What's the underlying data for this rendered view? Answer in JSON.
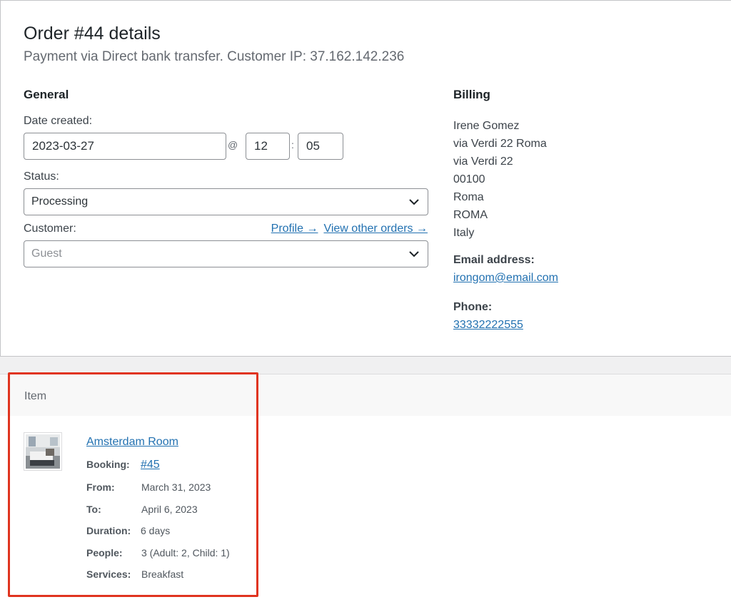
{
  "order": {
    "title": "Order #44 details",
    "subtitle": "Payment via Direct bank transfer. Customer IP: 37.162.142.236"
  },
  "general": {
    "heading": "General",
    "date_label": "Date created:",
    "date_value": "2023-03-27",
    "at_symbol": "@",
    "hour": "12",
    "colon": ":",
    "minute": "05",
    "status_label": "Status:",
    "status_value": "Processing",
    "customer_label": "Customer:",
    "profile_link": "Profile →",
    "other_orders_link": "View other orders →",
    "customer_value": "Guest"
  },
  "billing": {
    "heading": "Billing",
    "address_lines": [
      "Irene Gomez",
      "via Verdi 22 Roma",
      "via Verdi 22",
      "00100",
      "Roma",
      "ROMA",
      "Italy"
    ],
    "email_label": "Email address:",
    "email": "irongom@email.com",
    "phone_label": "Phone:",
    "phone": "33332222555"
  },
  "items": {
    "column_header": "Item",
    "item": {
      "name": "Amsterdam Room",
      "booking_label": "Booking:",
      "booking_value": "#45",
      "from_label": "From:",
      "from_value": "March 31, 2023",
      "to_label": "To:",
      "to_value": "April 6, 2023",
      "duration_label": "Duration:",
      "duration_value": "6 days",
      "people_label": "People:",
      "people_value": "3 (Adult: 2, Child: 1)",
      "services_label": "Services:",
      "services_value": "Breakfast"
    }
  },
  "colors": {
    "link": "#2271b1",
    "highlight_border": "#e0341f"
  }
}
